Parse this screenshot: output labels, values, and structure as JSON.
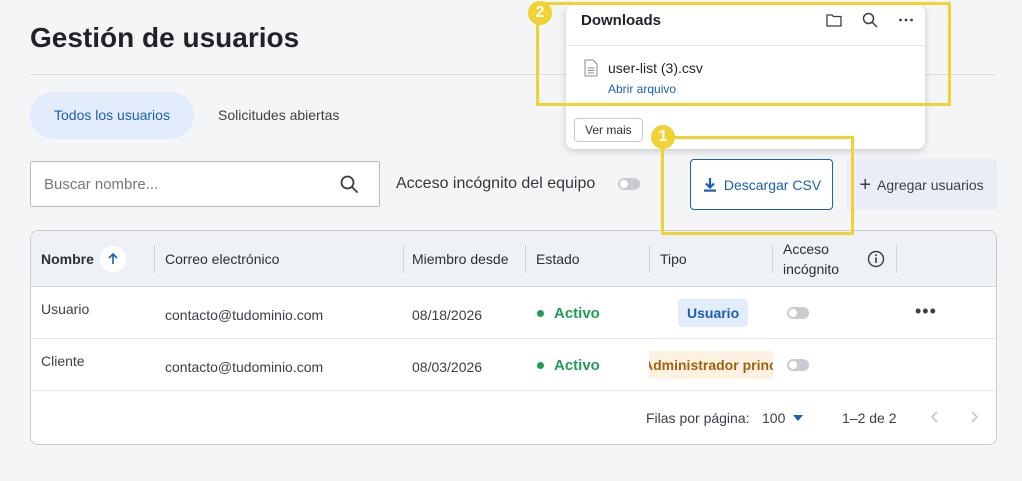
{
  "page": {
    "title": "Gestión de usuarios"
  },
  "tabs": [
    {
      "label": "Todos los usuarios",
      "active": true
    },
    {
      "label": "Solicitudes abiertas",
      "active": false
    }
  ],
  "search": {
    "placeholder": "Buscar nombre..."
  },
  "team_incognito": {
    "label": "Acceso incógnito del equipo",
    "enabled": false
  },
  "actions": {
    "download_csv": "Descargar CSV",
    "add_users": "Agregar usuarios"
  },
  "table": {
    "columns": {
      "name": "Nombre",
      "email": "Correo electrónico",
      "member_since": "Miembro desde",
      "status": "Estado",
      "type": "Tipo",
      "incognito_line1": "Acceso",
      "incognito_line2": "incógnito"
    },
    "rows": [
      {
        "name": "Usuario",
        "email": "contacto@tudominio.com",
        "member_since": "08/18/2026",
        "status": "Activo",
        "type": "Usuario",
        "incognito": false
      },
      {
        "name": "Cliente",
        "email": "contacto@tudominio.com",
        "member_since": "08/03/2026",
        "status": "Activo",
        "type": "Administrador principal",
        "incognito": false
      }
    ],
    "footer": {
      "rows_per_page_label": "Filas por página:",
      "rows_per_page": "100",
      "range": "1–2 de 2"
    }
  },
  "downloads": {
    "title": "Downloads",
    "file_name": "user-list (3).csv",
    "open_link": "Abrir arquivo",
    "more_button": "Ver mais"
  },
  "highlights": [
    {
      "number": "1"
    },
    {
      "number": "2"
    }
  ],
  "colors": {
    "accent": "#1a5fb4",
    "active_status": "#1f9d55",
    "highlight": "#f0d234",
    "admin_badge_bg": "#fdf2e1"
  }
}
